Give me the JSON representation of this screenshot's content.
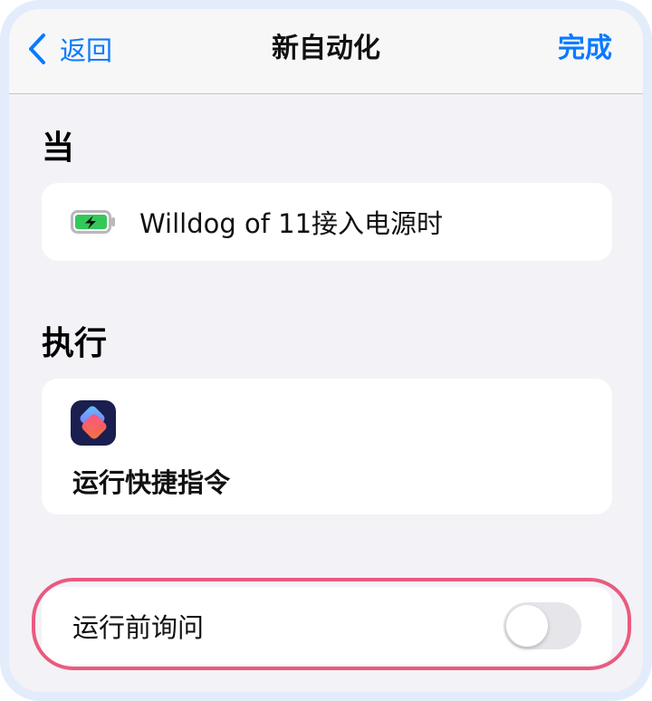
{
  "nav": {
    "back_label": "返回",
    "title": "新自动化",
    "done_label": "完成"
  },
  "when": {
    "header": "当",
    "trigger_icon": "battery-charging-icon",
    "trigger_text": "Willdog of 11接入电源时"
  },
  "do": {
    "header": "执行",
    "action_icon": "shortcuts-app-icon",
    "action_text": "运行快捷指令"
  },
  "ask": {
    "label": "运行前询问",
    "enabled": false
  },
  "colors": {
    "accent": "#0a7aff",
    "background": "#f2f2f7",
    "highlight": "#ea5a7f",
    "battery_green": "#34c759"
  }
}
